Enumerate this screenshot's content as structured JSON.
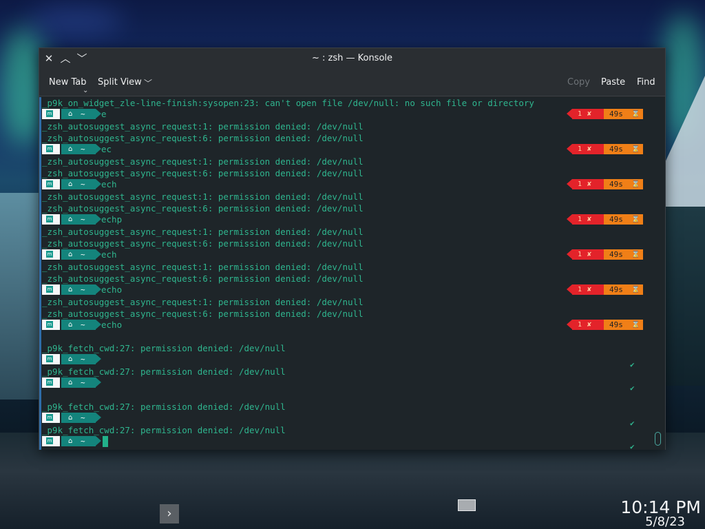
{
  "window": {
    "title": "~ : zsh — Konsole",
    "toolbar": {
      "new_tab": "New Tab",
      "split_view": "Split View",
      "copy": "Copy",
      "paste": "Paste",
      "find": "Find"
    }
  },
  "terminal": {
    "line_error": "_p9k_on_widget_zle-line-finish:sysopen:23: can't open file /dev/null: no such file or directory",
    "async_1": "_zsh_autosuggest_async_request:1: permission denied: /dev/null",
    "async_6": "_zsh_autosuggest_async_request:6: permission denied: /dev/null",
    "fetch_cwd": "_p9k_fetch_cwd:27: permission denied: /dev/null",
    "commands": [
      "e",
      "ec",
      "ech",
      "echp",
      "ech",
      "echo",
      "echo"
    ],
    "prompt_home": "~",
    "status_error_code": "1",
    "status_error_mark": "✘",
    "status_time": "49s",
    "status_time_icon": "⌛",
    "success_mark": "✔"
  },
  "taskbar": {
    "time": "10:14 PM",
    "date": "5/8/23"
  },
  "colors": {
    "prompt_teal": "#14847c",
    "text_green": "#2fb58e",
    "status_red": "#e3232a",
    "status_orange": "#f07f17"
  },
  "icons": {
    "close": "close-icon",
    "minimize": "chevron-up-icon",
    "maximize": "chevron-down-icon",
    "home": "home-icon",
    "os": "os-logo-icon",
    "hourglass": "hourglass-icon",
    "error": "error-cross-icon",
    "check": "check-icon",
    "expand": "chevron-right-icon"
  }
}
